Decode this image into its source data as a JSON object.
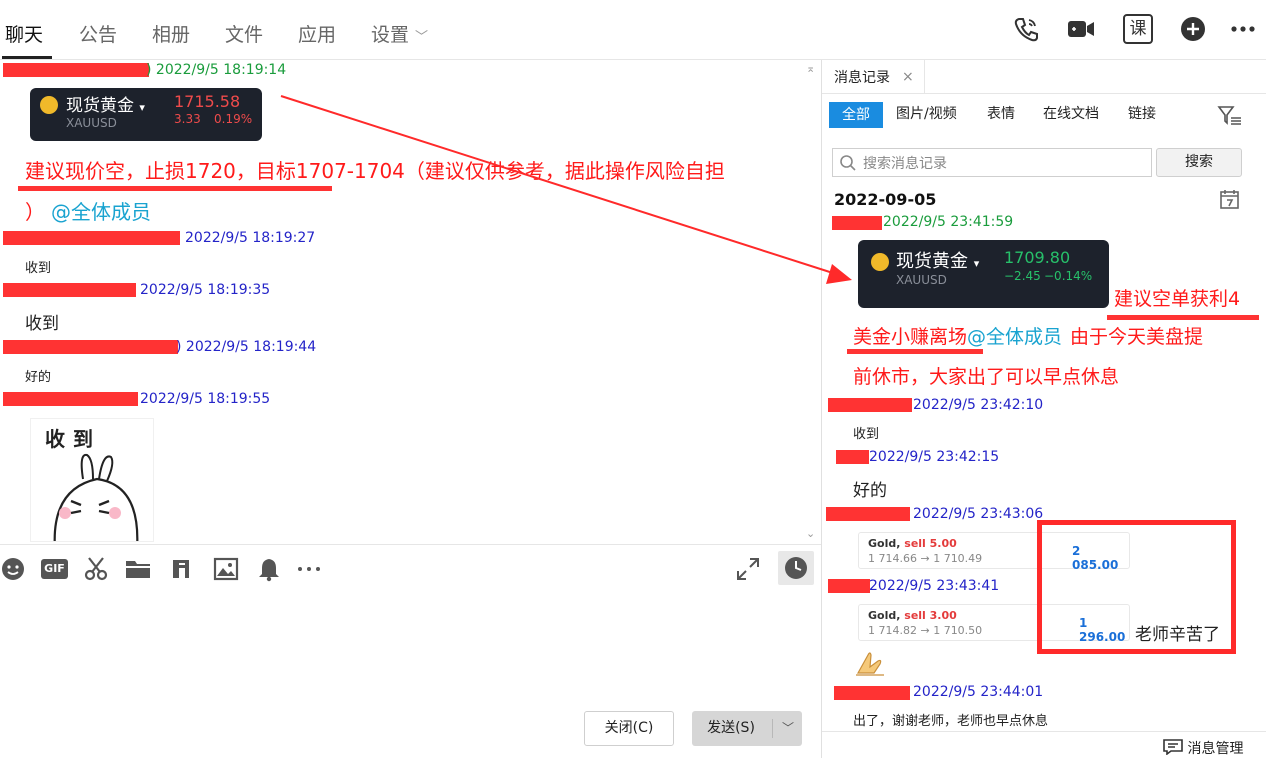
{
  "top_tabs": [
    {
      "label": "聊天",
      "active": true
    },
    {
      "label": "公告"
    },
    {
      "label": "相册"
    },
    {
      "label": "文件"
    },
    {
      "label": "应用"
    },
    {
      "label": "设置"
    }
  ],
  "top_icons": [
    "phone-icon",
    "video-icon",
    "course-icon",
    "add-icon",
    "more-icon"
  ],
  "course_label": "课",
  "chat": {
    "messages": [
      {
        "time": "2022/9/5 18:19:14"
      },
      {
        "time": "2022/9/5 18:19:27",
        "text": "收到"
      },
      {
        "time": "2022/9/5 18:19:35",
        "text": "收到"
      },
      {
        "time": "2022/9/5 18:19:44",
        "text": "好的"
      },
      {
        "time": "2022/9/5 18:19:55"
      }
    ],
    "gold_card": {
      "name": "现货黄金",
      "symbol": "XAUUSD",
      "price": "1715.58",
      "change": "3.33",
      "pct": "0.19%"
    },
    "advice_line1": "建议现价空，止损1720，目标1707-1704（建议仅供参考，据此操作风险自担",
    "advice_line2_prefix": "）",
    "advice_mention": "@全体成员",
    "sticker_text": "收到"
  },
  "toolbar_icons": [
    "emoji-icon",
    "gif-icon",
    "scissors-icon",
    "folder-icon",
    "music-icon",
    "image-icon",
    "bell-icon",
    "more-icon"
  ],
  "gif_label": "GIF",
  "buttons": {
    "close": "关闭(C)",
    "send": "发送(S)"
  },
  "history": {
    "tab_label": "消息记录",
    "filters": [
      {
        "label": "全部",
        "active": true
      },
      {
        "label": "图片/视频"
      },
      {
        "label": "表情"
      },
      {
        "label": "在线文档"
      },
      {
        "label": "链接"
      }
    ],
    "search_placeholder": "搜索消息记录",
    "search_button": "搜索",
    "date": "2022-09-05",
    "gold_card": {
      "name": "现货黄金",
      "symbol": "XAUUSD",
      "price": "1709.80",
      "change": "−2.45",
      "pct": "−0.14%"
    },
    "annotation_profit": "建议空单获利4",
    "note_part1": "美金小赚离场",
    "note_mention": "@全体成员",
    "note_part2": "由于今天美盘提",
    "note_line2": "前休市，大家出了可以早点休息",
    "messages": [
      {
        "time": "2022/9/5 23:41:59"
      },
      {
        "time": "2022/9/5 23:42:10",
        "text": "收到"
      },
      {
        "time": "2022/9/5 23:42:15",
        "text": "好的"
      },
      {
        "time": "2022/9/5 23:43:06"
      },
      {
        "time": "2022/9/5 23:43:41",
        "text": "老师辛苦了"
      },
      {
        "time": "2022/9/5 23:44:01",
        "text": "出了，谢谢老师，老师也早点休息"
      }
    ],
    "trades": [
      {
        "title": "Gold,",
        "side": "sell 5.00",
        "route": "1 714.66 → 1 710.49",
        "amount": "2 085.00"
      },
      {
        "title": "Gold,",
        "side": "sell 3.00",
        "route": "1 714.82 → 1 710.50",
        "amount": "1 296.00"
      }
    ],
    "manage_label": "消息管理"
  },
  "colors": {
    "accent": "#1a8ce0",
    "annotation": "#ff1a1a",
    "redact": "#ff3333",
    "mention": "#19a3d0"
  }
}
